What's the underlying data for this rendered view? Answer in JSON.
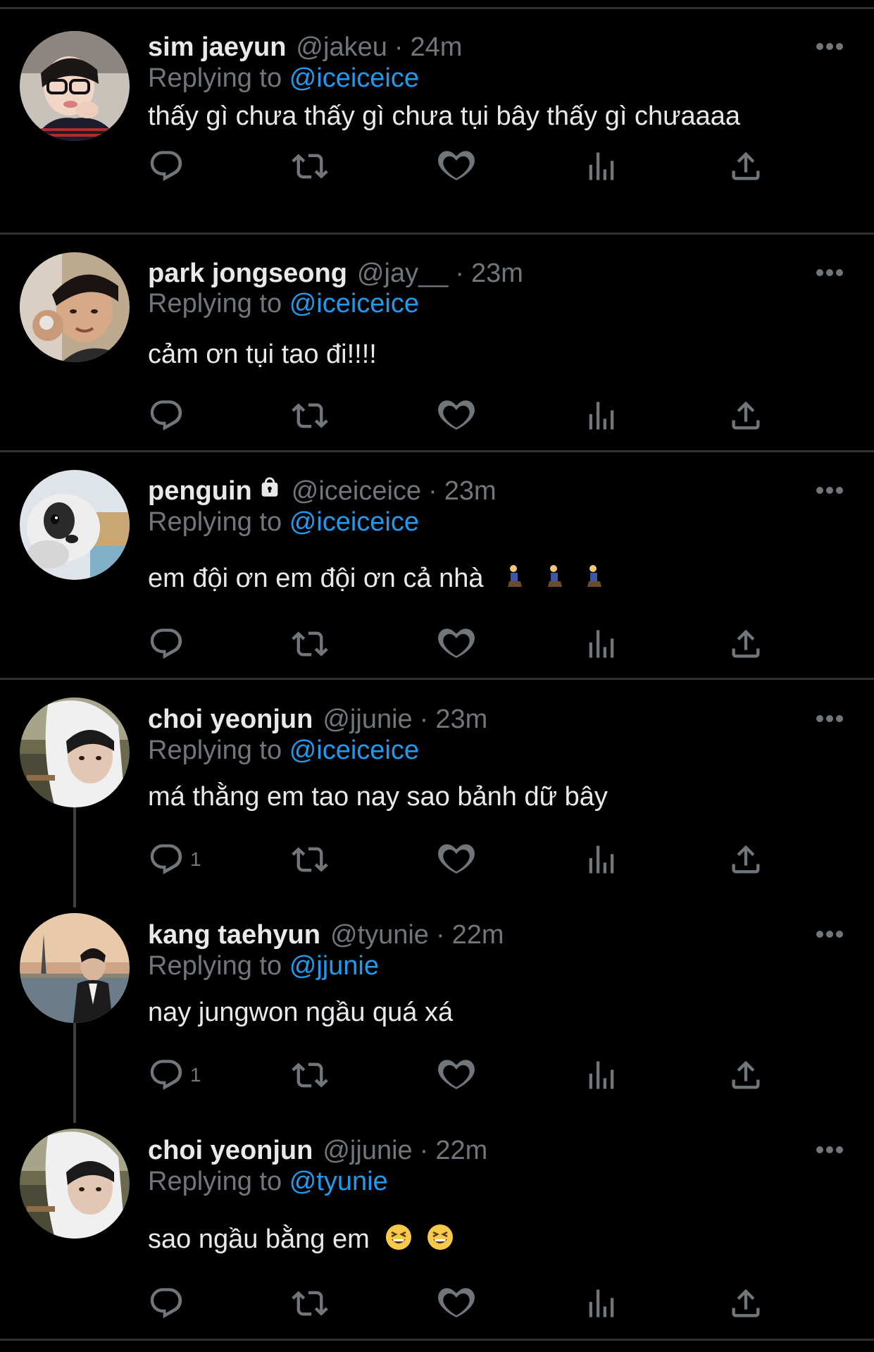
{
  "reply_prefix": "Replying to",
  "tweets": [
    {
      "name": "sim jaeyun",
      "handle": "@jakeu",
      "sep": "·",
      "time": "24m",
      "reply_to": "@iceiceice",
      "text": "thấy gì chưa thấy gì chưa tụi bây thấy gì chưaaaa",
      "reply_count": ""
    },
    {
      "name": "park jongseong",
      "handle": "@jay__",
      "sep": "·",
      "time": "23m",
      "reply_to": "@iceiceice",
      "text": "cảm ơn tụi tao đi!!!!",
      "reply_count": ""
    },
    {
      "name": "penguin",
      "handle": "@iceiceice",
      "sep": "·",
      "time": "23m",
      "reply_to": "@iceiceice",
      "text": "em đội ơn em đội ơn cả nhà",
      "reply_count": "",
      "locked": true,
      "emoji": [
        "person-kneeling",
        "person-kneeling",
        "person-kneeling"
      ]
    },
    {
      "name": "choi yeonjun",
      "handle": "@jjunie",
      "sep": "·",
      "time": "23m",
      "reply_to": "@iceiceice",
      "text": "má thằng em tao nay sao bảnh dữ bây",
      "reply_count": "1"
    },
    {
      "name": "kang taehyun",
      "handle": "@tyunie",
      "sep": "·",
      "time": "22m",
      "reply_to": "@jjunie",
      "text": "nay jungwon ngầu quá xá",
      "reply_count": "1"
    },
    {
      "name": "choi yeonjun",
      "handle": "@jjunie",
      "sep": "·",
      "time": "22m",
      "reply_to": "@tyunie",
      "text": "sao ngầu bằng em",
      "reply_count": "",
      "emoji": [
        "laughing-face",
        "laughing-face"
      ]
    }
  ],
  "icons": [
    "reply-icon",
    "retweet-icon",
    "like-icon",
    "views-icon",
    "share-icon",
    "more-icon",
    "lock-icon"
  ],
  "colors": {
    "background": "#000000",
    "text": "#e7e9ea",
    "muted": "#71767b",
    "link": "#1d9bf0",
    "divider": "#2f3336"
  }
}
